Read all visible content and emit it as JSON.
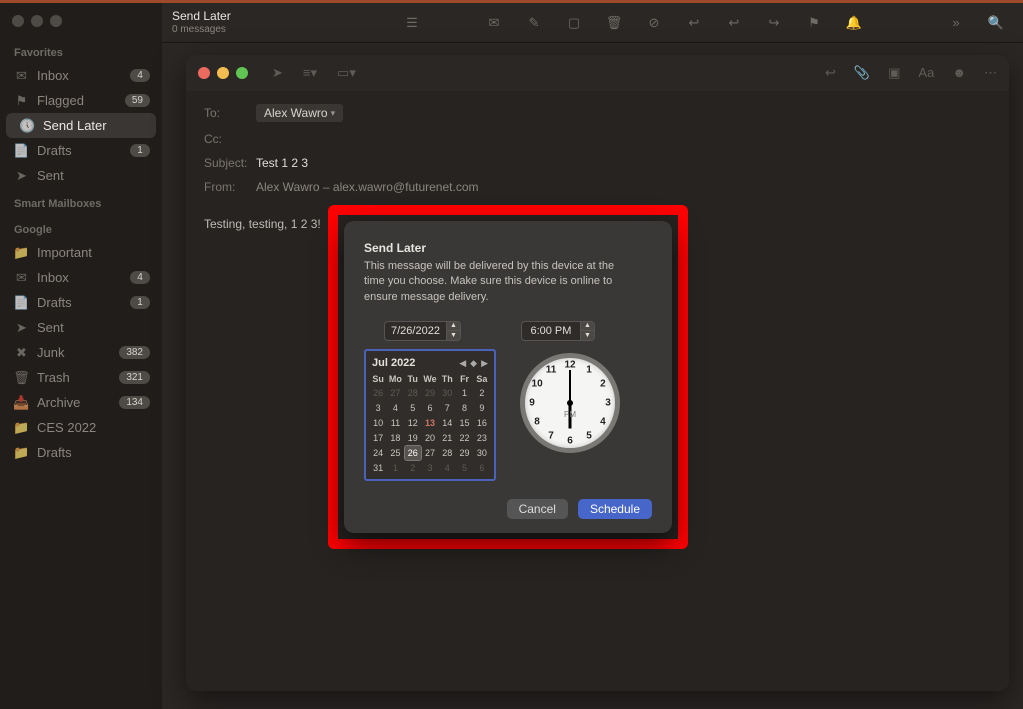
{
  "window": {
    "title": "Send Later",
    "subtitle": "0 messages"
  },
  "sidebar": {
    "sections": {
      "favorites_label": "Favorites",
      "smart_label": "Smart Mailboxes",
      "google_label": "Google"
    },
    "favorites": [
      {
        "icon": "inbox",
        "label": "Inbox",
        "badge": "4"
      },
      {
        "icon": "flag",
        "label": "Flagged",
        "badge": "59"
      },
      {
        "icon": "clock",
        "label": "Send Later",
        "badge": ""
      },
      {
        "icon": "doc",
        "label": "Drafts",
        "badge": "1"
      },
      {
        "icon": "send",
        "label": "Sent",
        "badge": ""
      }
    ],
    "google": [
      {
        "icon": "folder",
        "label": "Important",
        "badge": ""
      },
      {
        "icon": "inbox",
        "label": "Inbox",
        "badge": "4"
      },
      {
        "icon": "doc",
        "label": "Drafts",
        "badge": "1"
      },
      {
        "icon": "send",
        "label": "Sent",
        "badge": ""
      },
      {
        "icon": "junk",
        "label": "Junk",
        "badge": "382"
      },
      {
        "icon": "trash",
        "label": "Trash",
        "badge": "321"
      },
      {
        "icon": "archive",
        "label": "Archive",
        "badge": "134"
      },
      {
        "icon": "folder",
        "label": "CES 2022",
        "badge": ""
      },
      {
        "icon": "folder",
        "label": "Drafts",
        "badge": ""
      }
    ]
  },
  "compose": {
    "to_label": "To:",
    "to_recipient": "Alex Wawro",
    "cc_label": "Cc:",
    "subject_label": "Subject:",
    "subject_value": "Test 1 2 3",
    "from_label": "From:",
    "from_value": "Alex Wawro – alex.wawro@futurenet.com",
    "body": "Testing, testing, 1 2  3!"
  },
  "dialog": {
    "title": "Send Later",
    "description": "This message will be delivered by this device at the time you choose. Make sure this device is online to ensure message delivery.",
    "date_value": "7/26/2022",
    "time_value": "6:00 PM",
    "cancel_label": "Cancel",
    "schedule_label": "Schedule",
    "calendar": {
      "month_title": "Jul 2022",
      "dow": [
        "Su",
        "Mo",
        "Tu",
        "We",
        "Th",
        "Fr",
        "Sa"
      ],
      "leading": [
        "26",
        "27",
        "28",
        "29",
        "30"
      ],
      "days": [
        "1",
        "2",
        "3",
        "4",
        "5",
        "6",
        "7",
        "8",
        "9",
        "10",
        "11",
        "12",
        "13",
        "14",
        "15",
        "16",
        "17",
        "18",
        "19",
        "20",
        "21",
        "22",
        "23",
        "24",
        "25",
        "26",
        "27",
        "28",
        "29",
        "30",
        "31"
      ],
      "trailing": [
        "1",
        "2",
        "3",
        "4",
        "5",
        "6"
      ],
      "today_day": "13",
      "selected_day": "26"
    },
    "clock": {
      "ampm": "PM"
    }
  }
}
